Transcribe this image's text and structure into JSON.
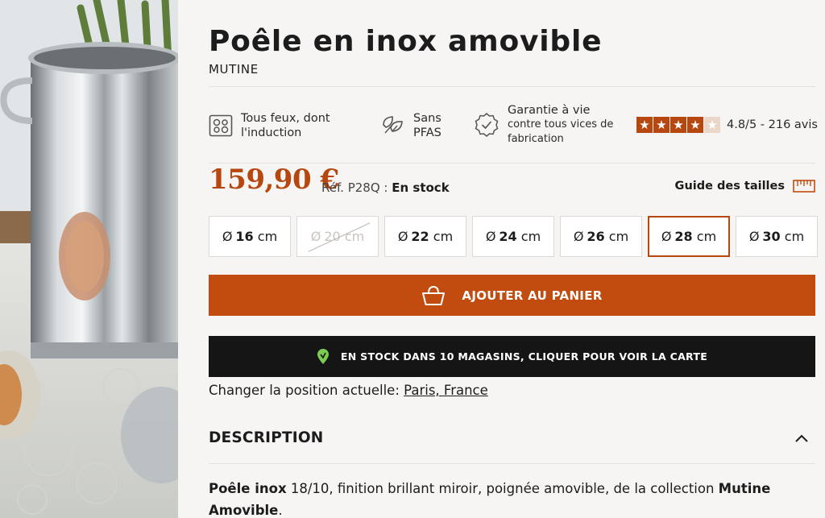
{
  "product": {
    "title": "Poêle en inox amovible",
    "brand": "MUTINE"
  },
  "features": [
    {
      "icon": "stovetop-icon",
      "line1": "Tous feux, dont",
      "line2": "l'induction"
    },
    {
      "icon": "leaves-icon",
      "line1": "Sans",
      "line2": "PFAS"
    },
    {
      "icon": "badge-check-icon",
      "line1": "Garantie à vie",
      "line2": "contre tous vices de",
      "line3": "fabrication"
    }
  ],
  "rating": {
    "value": 4.8,
    "stars_filled": 4,
    "stars_total": 5,
    "text": "4.8/5 - 216 avis"
  },
  "price": {
    "amount": "159,90 €",
    "ref_label": "Réf. P28Q :",
    "stock": "En stock"
  },
  "size_guide": {
    "label": "Guide des tailles",
    "icon": "ruler-icon"
  },
  "sizes": [
    {
      "symbol": "Ø",
      "value": "16",
      "unit": "cm",
      "state": "available"
    },
    {
      "symbol": "Ø",
      "value": "20",
      "unit": "cm",
      "state": "unavailable"
    },
    {
      "symbol": "Ø",
      "value": "22",
      "unit": "cm",
      "state": "available"
    },
    {
      "symbol": "Ø",
      "value": "24",
      "unit": "cm",
      "state": "available"
    },
    {
      "symbol": "Ø",
      "value": "26",
      "unit": "cm",
      "state": "available"
    },
    {
      "symbol": "Ø",
      "value": "28",
      "unit": "cm",
      "state": "selected"
    },
    {
      "symbol": "Ø",
      "value": "30",
      "unit": "cm",
      "state": "available"
    }
  ],
  "cart_button": {
    "label": "AJOUTER AU PANIER",
    "icon": "basket-icon"
  },
  "store_stock": {
    "label": "EN STOCK DANS 10 MAGASINS, CLIQUER POUR VOIR LA CARTE",
    "icon": "location-pin-icon"
  },
  "location": {
    "prefix": "Changer la position actuelle:",
    "value": "Paris, France"
  },
  "description": {
    "heading": "DESCRIPTION",
    "toggle_icon": "chevron-up-icon",
    "strong1": "Poêle inox",
    "text1": " 18/10, finition brillant miroir, poignée amovible, de la collection ",
    "strong2": "Mutine",
    "line2": "Amovible",
    "end": "."
  },
  "colors": {
    "accent": "#c24b0f",
    "price": "#b5470f",
    "dark_bar": "#151515",
    "background": "#f7f5f3"
  }
}
